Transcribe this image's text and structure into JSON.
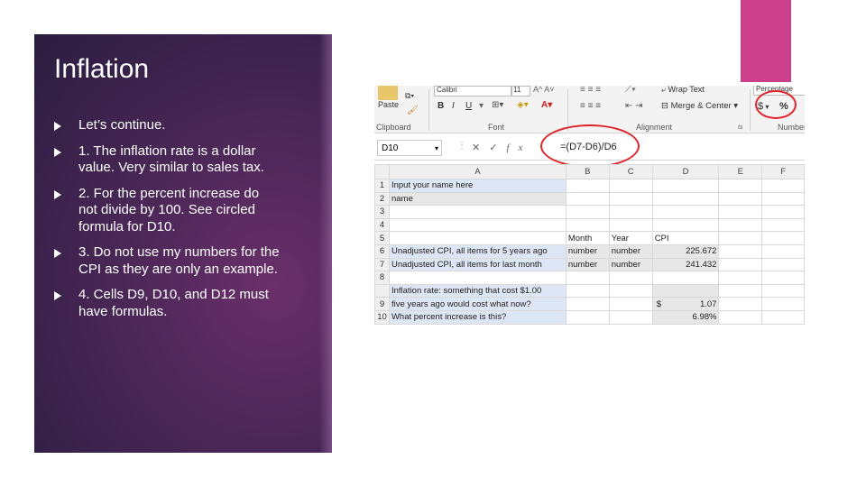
{
  "slide": {
    "title": "Inflation",
    "bullets": [
      "Let’s continue.",
      "1.  The inflation rate is a dollar value.  Very similar to sales tax.",
      "2. For the percent increase do not divide by 100.  See circled formula for D10.",
      "3. Do not use my numbers for the CPI as they are only an example.",
      "4. Cells D9, D10, and D12 must have formulas."
    ]
  },
  "colors": {
    "panel": "#4a2757",
    "accent": "#cc3f8b",
    "circle": "#e0242d"
  },
  "excel": {
    "ribbon": {
      "font_name": "Calibri",
      "font_size": "11",
      "paste_label": "Paste",
      "clipboard_label": "Clipboard",
      "font_label": "Font",
      "alignment_label": "Alignment",
      "number_label": "Number",
      "bold": "B",
      "italic": "I",
      "underline": "U",
      "wrap_text": "Wrap Text",
      "merge_center": "Merge & Center",
      "number_format": "Percentage",
      "currency_symbol": "$",
      "percent_symbol": "%"
    },
    "name_box": "D10",
    "formula": "=(D7-D6)/D6",
    "columns": [
      "A",
      "B",
      "C",
      "D",
      "E",
      "F"
    ],
    "rows": [
      {
        "n": "1",
        "a": "Input your name here",
        "b": "",
        "c": "",
        "d": ""
      },
      {
        "n": "2",
        "a": "name",
        "b": "",
        "c": "",
        "d": ""
      },
      {
        "n": "3",
        "a": "",
        "b": "",
        "c": "",
        "d": ""
      },
      {
        "n": "4",
        "a": "",
        "b": "",
        "c": "",
        "d": ""
      },
      {
        "n": "5",
        "a": "",
        "b": "Month",
        "c": "Year",
        "d": "CPI"
      },
      {
        "n": "6",
        "a": "Unadjusted CPI, all items for 5 years ago",
        "b": "number",
        "c": "number",
        "d": "225.672"
      },
      {
        "n": "7",
        "a": "Unadjusted CPI, all items for last month",
        "b": "number",
        "c": "number",
        "d": "241.432"
      },
      {
        "n": "8",
        "a": "",
        "b": "",
        "c": "",
        "d": ""
      },
      {
        "n": "",
        "a": "Inflation rate: something that cost $1.00",
        "b": "",
        "c": "",
        "d": ""
      },
      {
        "n": "9",
        "a": "five years ago would cost what now?",
        "b": "",
        "c": "",
        "d_cur": "$",
        "d": "1.07"
      },
      {
        "n": "10",
        "a": "What percent increase is this?",
        "b": "",
        "c": "",
        "d": "6.98%"
      }
    ]
  }
}
